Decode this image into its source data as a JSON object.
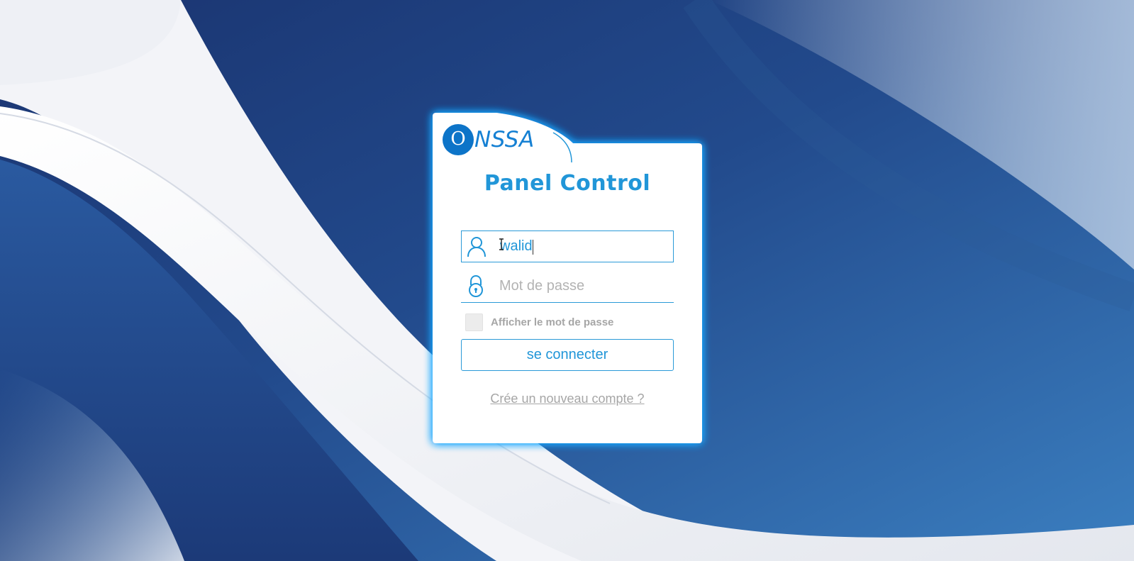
{
  "colors": {
    "accent": "#2196d8",
    "logo_blue": "#0d74c8",
    "background_dark": "#16306a",
    "background_light": "#f2f3f7",
    "placeholder": "#b3b3b3",
    "muted_text": "#a6a6a6"
  },
  "logo": {
    "initial": "O",
    "rest": "NSSA"
  },
  "login": {
    "title": "Panel Control",
    "username": {
      "value": "walid",
      "icon": "user-icon"
    },
    "password": {
      "value": "",
      "placeholder": "Mot de passe",
      "icon": "lock-icon"
    },
    "show_password_label": "Afficher le mot de passe",
    "show_password_checked": false,
    "submit_label": "se connecter",
    "create_account_link": "Crée un nouveau compte ?"
  }
}
